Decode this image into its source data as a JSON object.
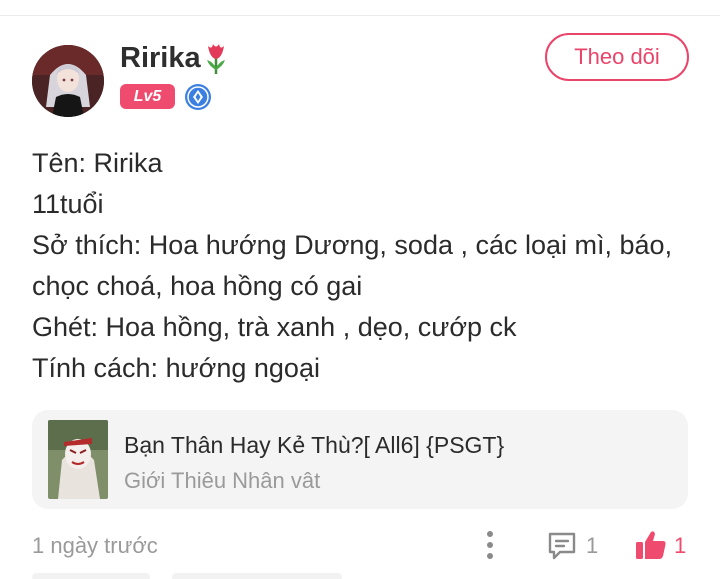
{
  "post": {
    "author": {
      "name": "Ririka",
      "level_badge": "Lv5",
      "avatar_icon": "avatar-icon",
      "name_emoji_icon": "tulip-icon",
      "verify_icon": "diamond-badge-icon"
    },
    "follow_button_label": "Theo dõi",
    "bio_lines": [
      "Tên: Ririka",
      "11tuổi",
      "Sở thích: Hoa hướng Dương, soda , các loại mì, báo,",
      "chọc choá, hoa hồng có gai",
      "Ghét: Hoa hồng, trà xanh , dẹo, cướp ck",
      "Tính cách: hướng ngoại"
    ],
    "story": {
      "title": "Bạn Thân Hay Kẻ Thù?[ All6] {PSGT}",
      "chapter": "Giới Thiêu Nhân vât"
    },
    "timestamp": "1 ngày trước",
    "comment_count": "1",
    "like_count": "1"
  },
  "colors": {
    "accent": "#e9446a",
    "badge": "#ef4b6e",
    "muted_text": "#9a9a9a",
    "card_bg": "#f4f4f4"
  }
}
